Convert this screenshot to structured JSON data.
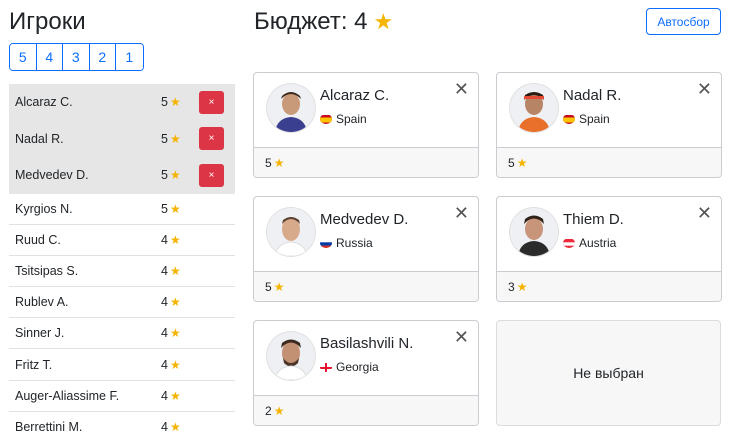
{
  "players_title": "Игроки",
  "filters": [
    "5",
    "4",
    "3",
    "2",
    "1"
  ],
  "players": [
    {
      "name": "Alcaraz C.",
      "cost": "5",
      "selected": true
    },
    {
      "name": "Nadal R.",
      "cost": "5",
      "selected": true
    },
    {
      "name": "Medvedev D.",
      "cost": "5",
      "selected": true
    },
    {
      "name": "Kyrgios N.",
      "cost": "5",
      "selected": false
    },
    {
      "name": "Ruud C.",
      "cost": "4",
      "selected": false
    },
    {
      "name": "Tsitsipas S.",
      "cost": "4",
      "selected": false
    },
    {
      "name": "Rublev A.",
      "cost": "4",
      "selected": false
    },
    {
      "name": "Sinner J.",
      "cost": "4",
      "selected": false
    },
    {
      "name": "Fritz T.",
      "cost": "4",
      "selected": false
    },
    {
      "name": "Auger-Aliassime F.",
      "cost": "4",
      "selected": false
    },
    {
      "name": "Berrettini M.",
      "cost": "4",
      "selected": false
    }
  ],
  "remove_symbol": "×",
  "budget": {
    "label": "Бюджет: 4"
  },
  "auto_button": "Автосбор",
  "star_icon": "★",
  "close_icon": "✕",
  "cards": [
    {
      "name": "Alcaraz C.",
      "country": "Spain",
      "cost": "5",
      "flag": "spain"
    },
    {
      "name": "Nadal R.",
      "country": "Spain",
      "cost": "5",
      "flag": "spain"
    },
    {
      "name": "Medvedev D.",
      "country": "Russia",
      "cost": "5",
      "flag": "russia"
    },
    {
      "name": "Thiem D.",
      "country": "Austria",
      "cost": "3",
      "flag": "austria"
    },
    {
      "name": "Basilashvili N.",
      "country": "Georgia",
      "cost": "2",
      "flag": "georgia"
    }
  ],
  "empty_slot": "Не выбран",
  "colors": {
    "accent": "#0d6efd",
    "danger": "#dc3545",
    "star": "#f5b400",
    "selected_row": "#e6e6e6"
  }
}
